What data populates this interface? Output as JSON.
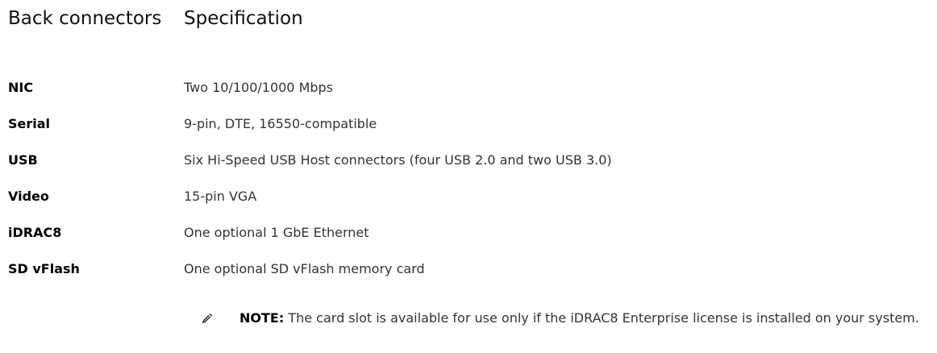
{
  "table": {
    "headers": {
      "col1": "Back connectors",
      "col2": "Specification"
    },
    "rows": [
      {
        "label": "NIC",
        "value": "Two 10/100/1000 Mbps"
      },
      {
        "label": "Serial",
        "value": "9-pin, DTE, 16550-compatible"
      },
      {
        "label": "USB",
        "value": "Six Hi-Speed USB Host connectors (four USB 2.0 and two USB 3.0)"
      },
      {
        "label": "Video",
        "value": "15-pin VGA"
      },
      {
        "label": "iDRAC8",
        "value": "One optional 1 GbE Ethernet"
      },
      {
        "label": "SD vFlash",
        "value": "One optional SD vFlash memory card"
      }
    ]
  },
  "note": {
    "icon": "pencil-icon",
    "label": "NOTE:",
    "text": " The card slot is available for use only if the iDRAC8 Enterprise license is installed on your system."
  }
}
